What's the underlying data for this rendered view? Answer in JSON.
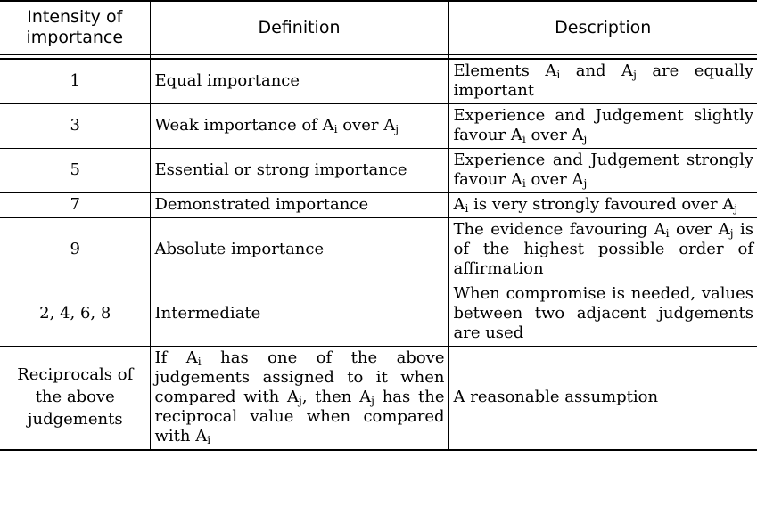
{
  "table": {
    "headers": [
      "Intensity of importance",
      "Definition",
      "Description"
    ],
    "rows": [
      {
        "intensity": "1",
        "definition": "Equal importance",
        "description": "Elements Aᵢ and Aⱼ are equally important",
        "definition_justified": false,
        "description_justified": true
      },
      {
        "intensity": "3",
        "definition": "Weak importance of Aᵢ over Aⱼ",
        "description": "Experience and Judgement slightly favour Aᵢ over Aⱼ",
        "definition_justified": true,
        "description_justified": true
      },
      {
        "intensity": "5",
        "definition": "Essential or strong importance",
        "description": "Experience and Judgement strongly favour Aᵢ over Aⱼ",
        "definition_justified": false,
        "description_justified": true
      },
      {
        "intensity": "7",
        "definition": "Demonstrated importance",
        "description": "Aᵢ is very strongly favoured over Aⱼ",
        "definition_justified": false,
        "description_justified": true
      },
      {
        "intensity": "9",
        "definition": "Absolute importance",
        "description": "The evidence favouring Aᵢ over Aⱼ is of the highest possible order of affirmation",
        "definition_justified": false,
        "description_justified": true
      },
      {
        "intensity": "2, 4, 6, 8",
        "definition": "Intermediate",
        "description": "When compromise is needed, values between two adjacent judgements are used",
        "definition_justified": false,
        "description_justified": true
      },
      {
        "intensity": "Reciprocals of the above judgements",
        "definition": "If Aᵢ has one of the above judgements assigned to it when compared with Aⱼ, then Aⱼ has the reciprocal value when compared with Aᵢ",
        "description": "A reasonable assumption",
        "definition_justified": true,
        "description_justified": false
      }
    ]
  },
  "colors": {
    "border": "#000000",
    "text": "#000000",
    "background": "#ffffff"
  }
}
